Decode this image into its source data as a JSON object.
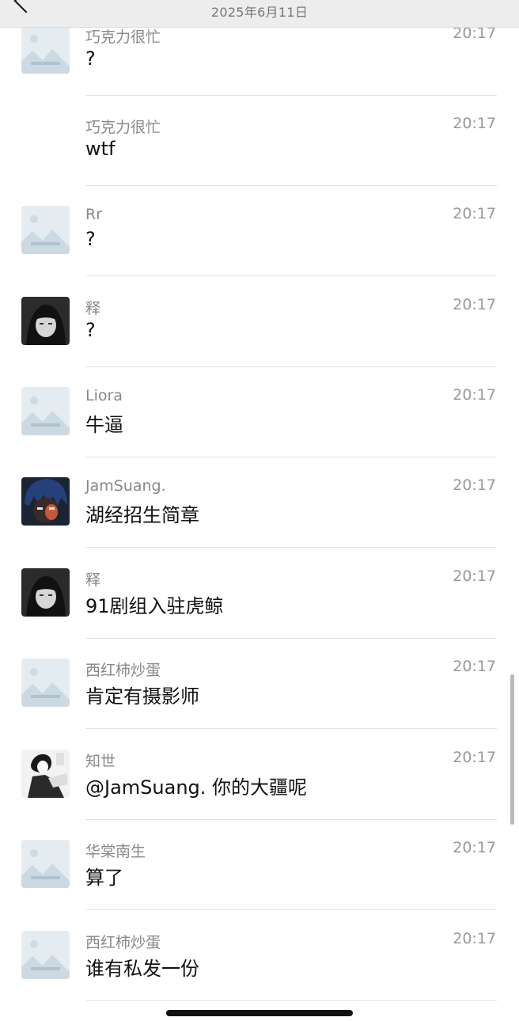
{
  "header": {
    "date": "2025年6月11日"
  },
  "messages": [
    {
      "name": "巧克力很忙",
      "time": "20:17",
      "text": "?",
      "avatar": "placeholder"
    },
    {
      "name": "巧克力很忙",
      "time": "20:17",
      "text": "wtf",
      "avatar": "none"
    },
    {
      "name": "Rr",
      "time": "20:17",
      "text": "?",
      "avatar": "placeholder"
    },
    {
      "name": "释",
      "time": "20:17",
      "text": "?",
      "avatar": "dark-hood"
    },
    {
      "name": "Liora",
      "time": "20:17",
      "text": "牛逼",
      "avatar": "placeholder"
    },
    {
      "name": "JamSuang.",
      "time": "20:17",
      "text": "湖经招生简章",
      "avatar": "blue-anime"
    },
    {
      "name": "释",
      "time": "20:17",
      "text": "91剧组入驻虎鲸",
      "avatar": "dark-hood"
    },
    {
      "name": "西红柿炒蛋",
      "time": "20:17",
      "text": "肯定有摄影师",
      "avatar": "placeholder"
    },
    {
      "name": "知世",
      "time": "20:17",
      "text": "@JamSuang. 你的大疆呢",
      "avatar": "sketch"
    },
    {
      "name": "华棠南生",
      "time": "20:17",
      "text": "算了",
      "avatar": "placeholder"
    },
    {
      "name": "西红柿炒蛋",
      "time": "20:17",
      "text": "谁有私发一份",
      "avatar": "placeholder"
    }
  ]
}
